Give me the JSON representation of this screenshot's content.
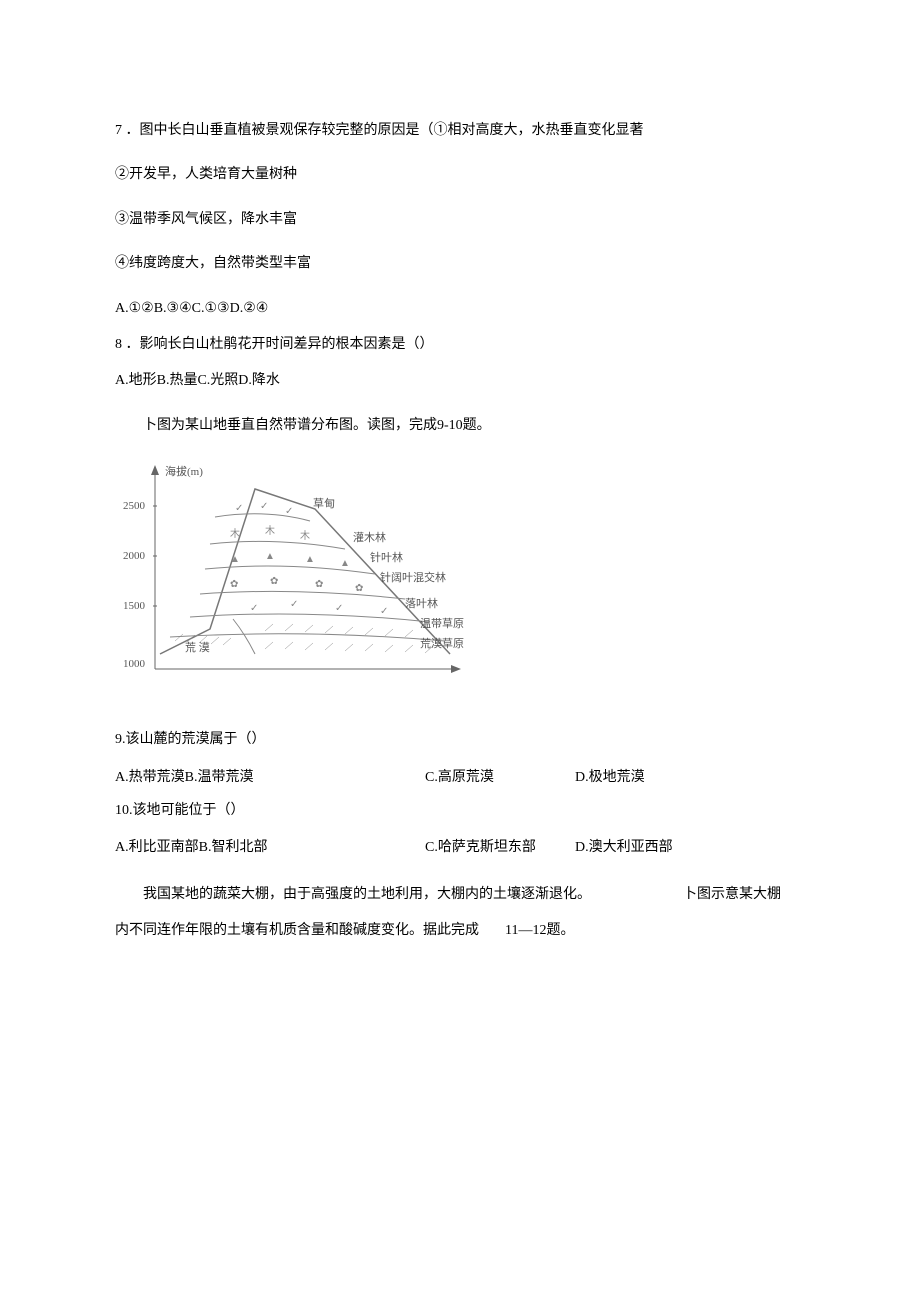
{
  "q7": {
    "stem_a": "7 ．图中长白山垂直植被景观保存较完整的原因是（①相对高度大，水热垂直变化显著",
    "stmt2": "②开发早，人类培育大量树种",
    "stmt3": "③温带季风气候区，降水丰富",
    "stmt4": "④纬度跨度大，自然带类型丰富",
    "options": "A.①②B.③④C.①③D.②④"
  },
  "q8": {
    "stem": "8 ．影响长白山杜鹃花开时间差异的根本因素是（）",
    "options": "A.地形B.热量C.光照D.降水"
  },
  "intro910": "卜图为某山地垂直自然带谱分布图。读图，完成9-10题。",
  "figure": {
    "yaxis": "海拔(m)",
    "y2500": "2500",
    "y2000": "2000",
    "y1500": "1500",
    "y1000": "1000",
    "lab1": "草甸",
    "lab2": "灌木林",
    "lab3": "针叶林",
    "lab4": "针阔叶混交林",
    "lab5": "落叶林",
    "lab6": "温带草原",
    "lab7": "荒漠草原",
    "lab8": "荒 漠"
  },
  "q9": {
    "stem": "9.该山麓的荒漠属于（）",
    "a": "A.热带荒漠B.温带荒漠",
    "c": "C.高原荒漠",
    "d": "D.极地荒漠"
  },
  "q10": {
    "stem": "10.该地可能位于（）",
    "a": "A.利比亚南部B.智利北部",
    "c": "C.哈萨克斯坦东部",
    "d": "D.澳大利亚西部"
  },
  "intro1112": {
    "part1": "我国某地的蔬菜大棚，由于高强度的土地利用，大棚内的土壤逐渐退化。",
    "part2": "卜图示意某大棚",
    "part3": "内不同连作年限的土壤有机质含量和酸碱度变化。据此完成",
    "part4": "11—12题。"
  }
}
